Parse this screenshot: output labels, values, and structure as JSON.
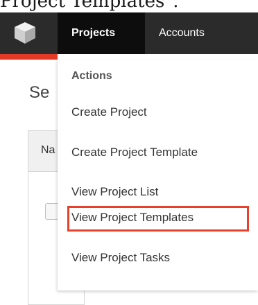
{
  "caption": "Project Templates\".",
  "navbar": {
    "logo_icon": "cube-logo-icon",
    "tabs": [
      {
        "label": "Projects",
        "active": true
      },
      {
        "label": "Accounts",
        "active": false
      }
    ],
    "accent_color": "#e23a26"
  },
  "page": {
    "heading": "Se",
    "panel_header": "Na"
  },
  "dropdown": {
    "header": "Actions",
    "items": [
      {
        "label": "Create Project"
      },
      {
        "label": "Create Project Template"
      },
      {
        "label": "View Project List"
      },
      {
        "label": "View Project Templates",
        "highlighted": true
      },
      {
        "label": "View Project Tasks"
      }
    ],
    "highlight_color": "#e8402b"
  }
}
